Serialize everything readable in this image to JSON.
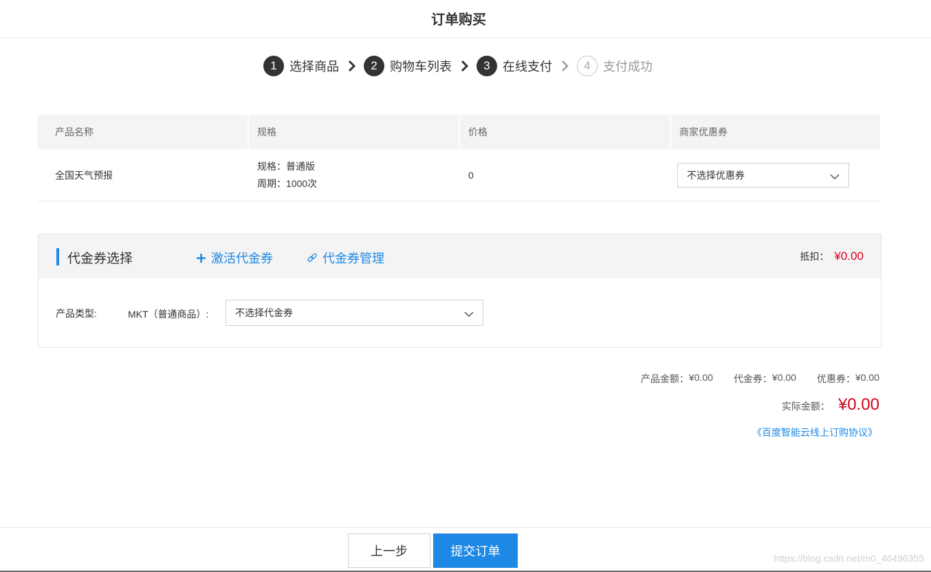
{
  "header": {
    "title": "订单购买"
  },
  "steps": [
    {
      "num": "1",
      "label": "选择商品"
    },
    {
      "num": "2",
      "label": "购物车列表"
    },
    {
      "num": "3",
      "label": "在线支付"
    },
    {
      "num": "4",
      "label": "支付成功"
    }
  ],
  "table": {
    "headers": [
      "产品名称",
      "规格",
      "价格",
      "商家优惠券"
    ],
    "row": {
      "name": "全国天气预报",
      "spec": "规格：普通版",
      "period": "周期：1000次",
      "price": "0",
      "coupon_select": "不选择优惠券"
    }
  },
  "voucher": {
    "title": "代金券选择",
    "activate_link": "激活代金券",
    "manage_link": "代金券管理",
    "deduct_label": "抵扣：",
    "deduct_value": "¥0.00",
    "product_type_label": "产品类型:",
    "product_type_value": "MKT（普通商品）:",
    "voucher_select": "不选择代金券"
  },
  "summary": {
    "product_amount_label": "产品金额：",
    "product_amount": "¥0.00",
    "voucher_label": "代金券：",
    "voucher_amount": "¥0.00",
    "coupon_label": "优惠券：",
    "coupon_amount": "¥0.00",
    "actual_label": "实际金额：",
    "actual_amount": "¥0.00",
    "agreement": "《百度智能云线上订购协议》"
  },
  "footer": {
    "prev_button": "上一步",
    "submit_button": "提交订单"
  },
  "watermark": "https://blog.csdn.net/m0_46496355",
  "colors": {
    "accent": "#1e88e5",
    "price_red": "#d0021b",
    "step_active": "#333333"
  }
}
